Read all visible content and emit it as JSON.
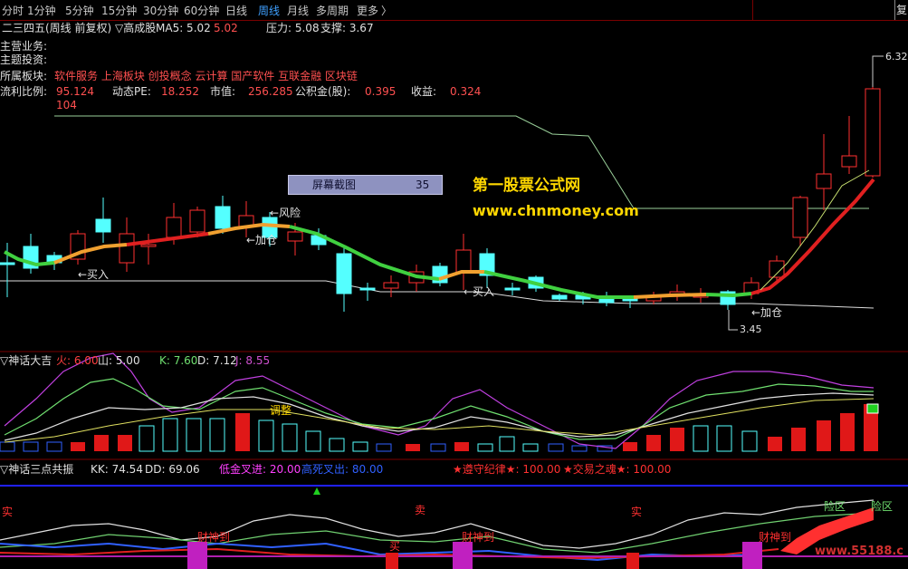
{
  "toolbar": {
    "tabs": [
      "分时",
      "1分钟",
      "5分钟",
      "15分钟",
      "30分钟",
      "60分钟",
      "日线",
      "周线",
      "月线",
      "多周期",
      "更多"
    ],
    "active_index": 7,
    "more_arrow": "〉",
    "right_btn": "复"
  },
  "main_panel": {
    "title": "二三四五(周线 前复权) ▽高成股",
    "ma5_label": "MA5: 5.02",
    "ma5_b": "5.02",
    "pressure": "压力: 5.08",
    "support": "支撑: 3.67",
    "info_rows": [
      {
        "label": "主营业务:",
        "value": ""
      },
      {
        "label": "主题投资:",
        "value": ""
      },
      {
        "label": "所属板块:",
        "value": "软件服务      上海板块      创投概念 云计算 国产软件 互联金融 区块链"
      }
    ],
    "ratio_label": "流利比例:",
    "ratio_value": "95.124",
    "pe_label": "动态PE:",
    "pe_value": "18.252",
    "mv_label": "市值:",
    "mv_value": "256.285",
    "fund_label": "公积金(股):",
    "fund_value": "0.395",
    "income_label": "收益:",
    "income_value": "0.324",
    "extra_value": "104",
    "high_price": "6.32",
    "low_price": "3.45",
    "annotations": {
      "buy1": "←买入",
      "risk": "←风险",
      "add1": "←加仓",
      "buy2": "←买入",
      "add2": "←加仓"
    },
    "screenshot_box": {
      "label": "屏幕截图",
      "value": "35"
    },
    "watermark_cn": "第一股票公式网",
    "watermark_url": "www.chnmoney.com"
  },
  "panel2": {
    "title": "▽神话大吉",
    "fire": "火: 6.00",
    "mountain": "山: 5.00",
    "k": "K: 7.60",
    "d": "D: 7.12",
    "j": "J: 8.55",
    "adjust": "调整"
  },
  "panel3": {
    "title": "▽神话三点共振",
    "kk": "KK: 74.54",
    "dd": "DD: 69.06",
    "low_gold": "低金叉进: 20.00",
    "high_dead": "高死叉出: 80.00",
    "discipline": "★遵守纪律★: 100.00",
    "soul": "★交易之魂★: 100.00",
    "marks": {
      "m1": "实",
      "m2": "卖",
      "m3": "实",
      "god": "财神到",
      "buy": "买",
      "risk1": "险区",
      "risk2": "险区"
    },
    "site": "www.55188.c"
  },
  "colors": {
    "up": "#ff3030",
    "down": "#54ffff",
    "active_tab": "#3fa0ff",
    "divider": "#7a0000",
    "label_red": "#ff5050",
    "magenta": "#ff40ff",
    "yellow": "#ffd700"
  }
}
